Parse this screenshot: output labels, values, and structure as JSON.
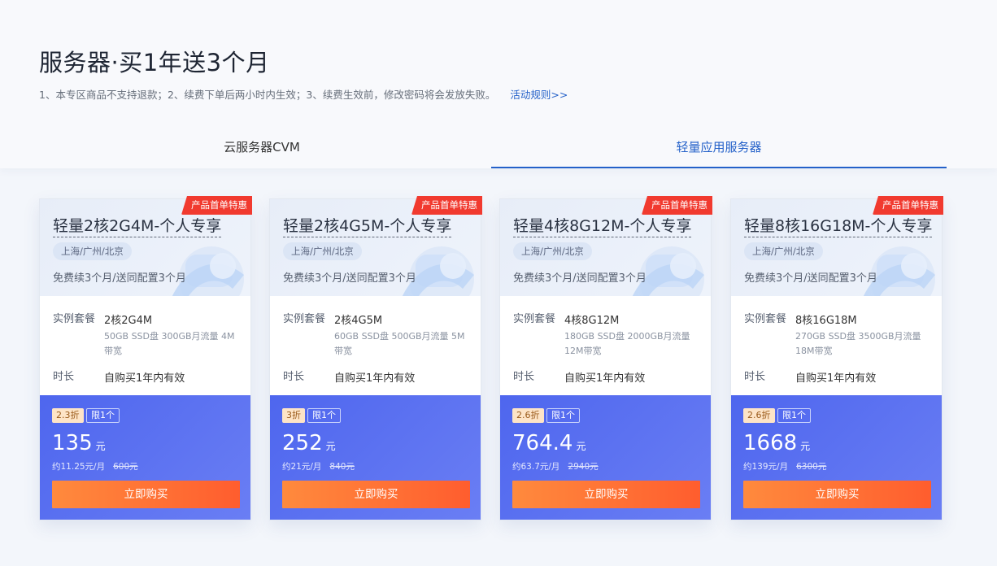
{
  "page": {
    "title": "服务器·买1年送3个月",
    "notice": "1、本专区商品不支持退款；2、续费下单后两小时内生效；3、续费生效前，修改密码将会发放失败。",
    "rules_link": "活动规则>>"
  },
  "tabs": [
    {
      "label": "云服务器CVM",
      "active": false
    },
    {
      "label": "轻量应用服务器",
      "active": true
    }
  ],
  "colors": {
    "accent": "#2461c9",
    "ribbon": "#f13a2f",
    "price_bg": "#5a6ef0",
    "buy_button": "#ff6a32"
  },
  "cards": [
    {
      "ribbon": "产品首单特惠",
      "name": "轻量2核2G4M-个人专享",
      "region": "上海/广州/北京",
      "promo": "免费续3个月/送同配置3个月",
      "spec_label": "实例套餐",
      "spec_value": "2核2G4M",
      "spec_detail": "50GB SSD盘 300GB月流量 4M带宽",
      "duration_label": "时长",
      "duration_value": "自购买1年内有效",
      "discount": "2.3折",
      "limit": "限1个",
      "price": "135",
      "price_unit": "元",
      "monthly": "约11.25元/月",
      "original_price": "600元",
      "buy_label": "立即购买"
    },
    {
      "ribbon": "产品首单特惠",
      "name": "轻量2核4G5M-个人专享",
      "region": "上海/广州/北京",
      "promo": "免费续3个月/送同配置3个月",
      "spec_label": "实例套餐",
      "spec_value": "2核4G5M",
      "spec_detail": "60GB SSD盘 500GB月流量 5M带宽",
      "duration_label": "时长",
      "duration_value": "自购买1年内有效",
      "discount": "3折",
      "limit": "限1个",
      "price": "252",
      "price_unit": "元",
      "monthly": "约21元/月",
      "original_price": "840元",
      "buy_label": "立即购买"
    },
    {
      "ribbon": "产品首单特惠",
      "name": "轻量4核8G12M-个人专享",
      "region": "上海/广州/北京",
      "promo": "免费续3个月/送同配置3个月",
      "spec_label": "实例套餐",
      "spec_value": "4核8G12M",
      "spec_detail": "180GB SSD盘 2000GB月流量 12M带宽",
      "duration_label": "时长",
      "duration_value": "自购买1年内有效",
      "discount": "2.6折",
      "limit": "限1个",
      "price": "764.4",
      "price_unit": "元",
      "monthly": "约63.7元/月",
      "original_price": "2940元",
      "buy_label": "立即购买"
    },
    {
      "ribbon": "产品首单特惠",
      "name": "轻量8核16G18M-个人专享",
      "region": "上海/广州/北京",
      "promo": "免费续3个月/送同配置3个月",
      "spec_label": "实例套餐",
      "spec_value": "8核16G18M",
      "spec_detail": "270GB SSD盘 3500GB月流量 18M带宽",
      "duration_label": "时长",
      "duration_value": "自购买1年内有效",
      "discount": "2.6折",
      "limit": "限1个",
      "price": "1668",
      "price_unit": "元",
      "monthly": "约139元/月",
      "original_price": "6300元",
      "buy_label": "立即购买"
    }
  ]
}
